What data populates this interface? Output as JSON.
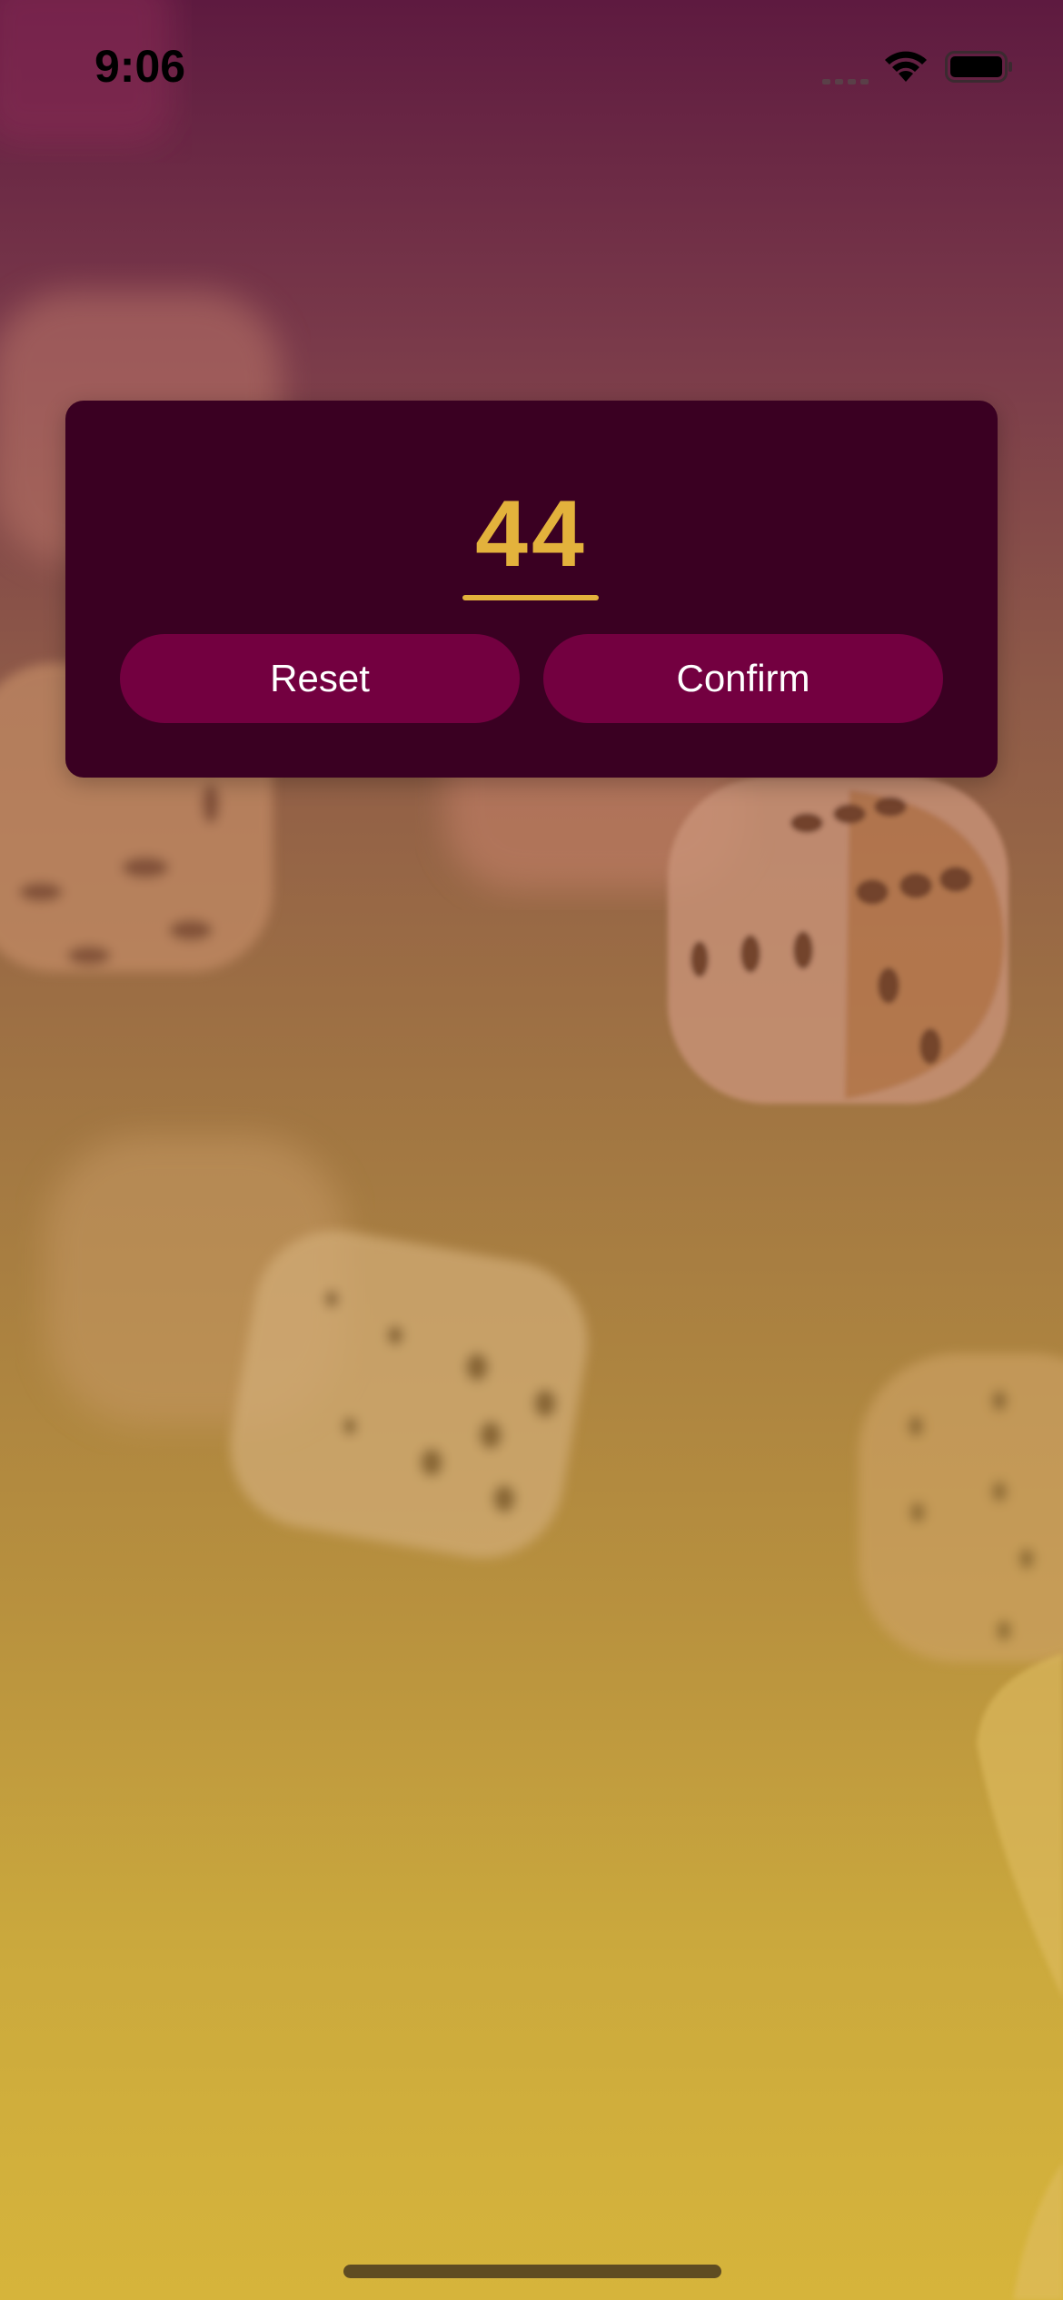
{
  "status_bar": {
    "time": "9:06"
  },
  "dialog": {
    "value": "44",
    "reset_label": "Reset",
    "confirm_label": "Confirm"
  },
  "colors": {
    "card_background": "#3a0022",
    "button_background": "#730040",
    "accent": "#e3b23c",
    "button_text": "#ffffff"
  },
  "icons": [
    "cellular-signal-icon",
    "wifi-icon",
    "battery-icon"
  ]
}
